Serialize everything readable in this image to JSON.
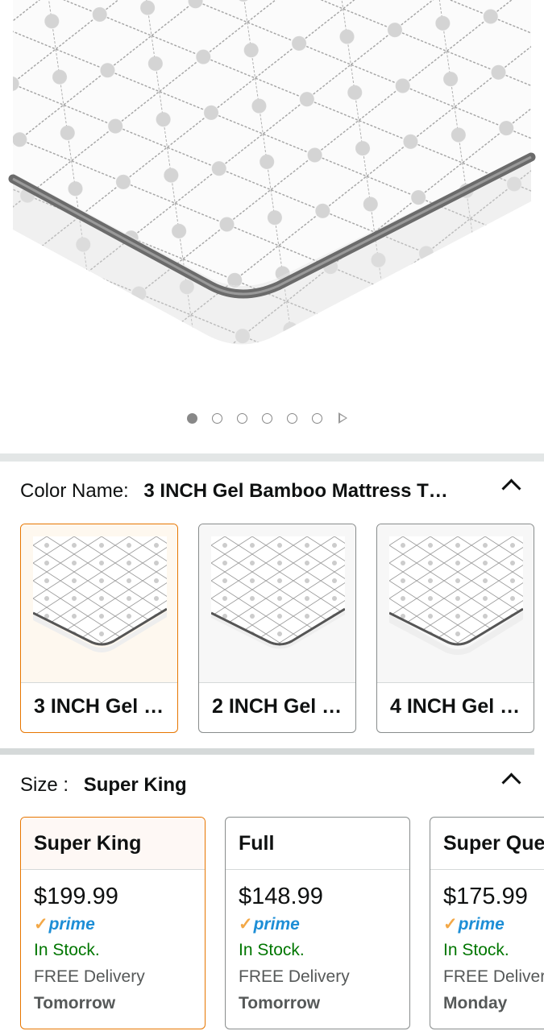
{
  "gallery": {
    "image_count": 6,
    "active_index": 0,
    "image_alt": "Gel bamboo mattress topper with quilted diamond pattern and grey piping"
  },
  "color": {
    "label": "Color Name:",
    "selected": "3 INCH Gel Bamboo Mattress T…",
    "options": [
      {
        "label": "3 INCH Gel …"
      },
      {
        "label": "2 INCH Gel …"
      },
      {
        "label": "4 INCH Gel …"
      }
    ]
  },
  "size": {
    "label": "Size :",
    "selected": "Super King",
    "options": [
      {
        "name": "Super King",
        "price": "$199.99",
        "prime": "prime",
        "stock": "In Stock.",
        "delivery": "FREE Delivery",
        "day": "Tomorrow"
      },
      {
        "name": "Full",
        "price": "$148.99",
        "prime": "prime",
        "stock": "In Stock.",
        "delivery": "FREE Delivery",
        "day": "Tomorrow"
      },
      {
        "name": "Super Queen",
        "price": "$175.99",
        "prime": "prime",
        "stock": "In Stock.",
        "delivery": "FREE Delivery",
        "day": "Monday"
      }
    ]
  },
  "colors": {
    "accent": "#e77600",
    "in_stock": "#007600",
    "prime_blue": "#1d8ed6",
    "prime_check": "#f3a847"
  }
}
